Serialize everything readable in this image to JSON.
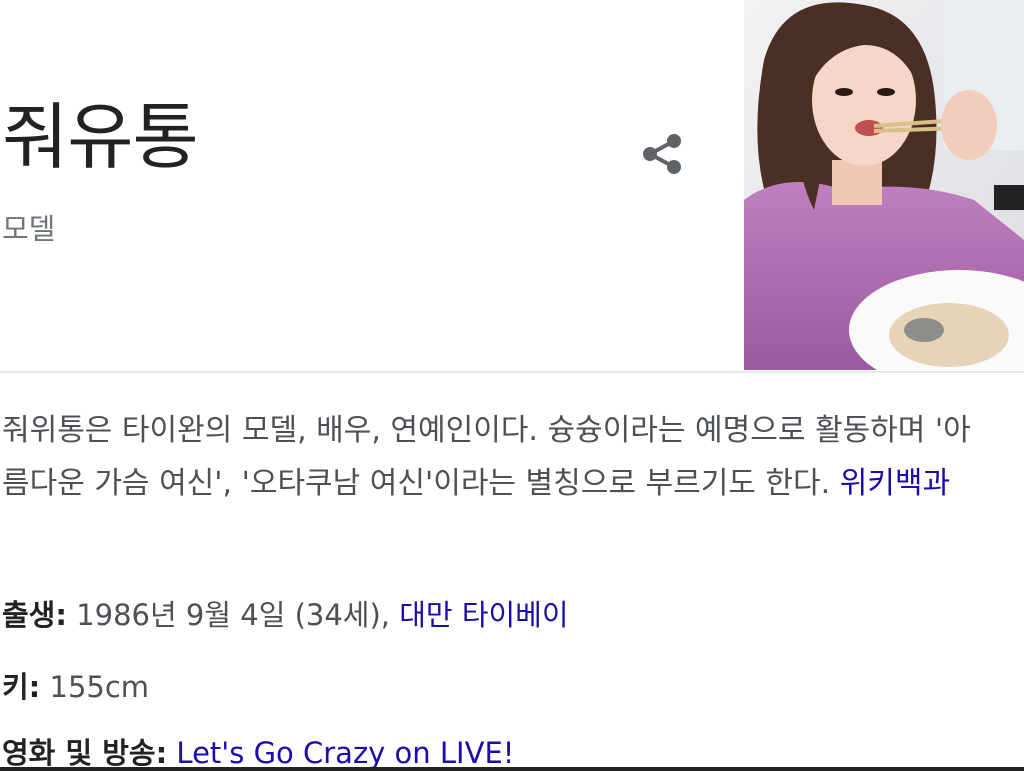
{
  "entity": {
    "title": "줘유통",
    "subtitle": "모델"
  },
  "share_icon": "share-icon",
  "description": {
    "text": "줘위통은 타이완의 모델, 배우, 연예인이다. 슝슝이라는 예명으로 활동하며 '아름다운 가슴 여신', '오타쿠남 여신'이라는 별칭으로 부르기도 한다. ",
    "source_link": "위키백과"
  },
  "facts": {
    "birth": {
      "label": "출생:",
      "value": "1986년 9월 4일 (34세), ",
      "place_link": "대만 타이베이"
    },
    "height": {
      "label": "키:",
      "value": "155cm"
    },
    "films": {
      "label": "영화 및 방송:",
      "link": "Let's Go Crazy on LIVE!"
    }
  },
  "colors": {
    "link": "#1a0dab",
    "text": "#4d5156",
    "subtitle": "#70757a"
  }
}
